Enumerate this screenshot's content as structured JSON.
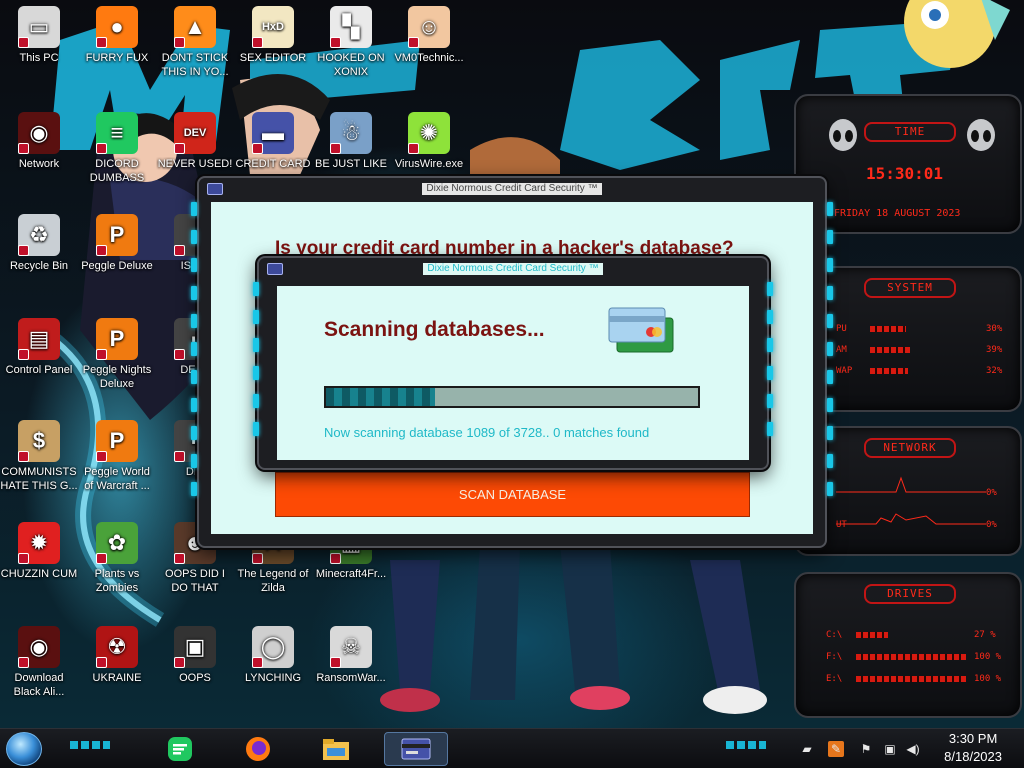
{
  "desktop": {
    "icons": [
      {
        "label": "This PC",
        "icon": "this-pc-icon"
      },
      {
        "label": "FURRY FUX",
        "icon": "firefox-icon"
      },
      {
        "label": "DONT STICK THIS IN YO...",
        "icon": "vlc-cone-icon"
      },
      {
        "label": "SEX EDITOR",
        "icon": "hxd-editor-icon"
      },
      {
        "label": "HOOKED ON XONIX",
        "icon": "xonix-game-icon"
      },
      {
        "label": "VM0Technic...",
        "icon": "doctor-icon"
      },
      {
        "label": "Network",
        "icon": "alien-network-icon"
      },
      {
        "label": "DICORD DUMBASS",
        "icon": "chat-app-icon"
      },
      {
        "label": "NEVER USED!",
        "icon": "dev-cpp-icon"
      },
      {
        "label": "CREDIT CARD",
        "icon": "credit-card-icon"
      },
      {
        "label": "BE JUST LIKE",
        "icon": "santa-icon"
      },
      {
        "label": "VirusWire.exe",
        "icon": "lime-icon"
      },
      {
        "label": "Recycle Bin",
        "icon": "recycle-bin-icon"
      },
      {
        "label": "Peggle Deluxe",
        "icon": "peggle-icon"
      },
      {
        "label": "ISRAI",
        "icon": "app-icon"
      },
      {
        "label": "Control Panel",
        "icon": "control-panel-icon"
      },
      {
        "label": "Peggle Nights Deluxe",
        "icon": "peggle-icon"
      },
      {
        "label": "DEEZ",
        "icon": "app-icon"
      },
      {
        "label": "COMMUNISTS HATE THIS G...",
        "icon": "money-bag-icon"
      },
      {
        "label": "Peggle World of Warcraft ...",
        "icon": "peggle-icon"
      },
      {
        "label": "DIE",
        "icon": "app-icon"
      },
      {
        "label": "CHUZZIN CUM",
        "icon": "chuzzle-icon"
      },
      {
        "label": "Plants vs Zombies",
        "icon": "plants-icon"
      },
      {
        "label": "OOPS DID I DO THAT",
        "icon": "person-icon"
      },
      {
        "label": "The Legend of Zilda",
        "icon": "zelda-icon"
      },
      {
        "label": "Minecraft4Fr...",
        "icon": "minecraft-icon"
      },
      {
        "label": "Download Black Ali...",
        "icon": "alien-download-icon"
      },
      {
        "label": "UKRAINE",
        "icon": "radiation-icon"
      },
      {
        "label": "OOPS",
        "icon": "oops-icon"
      },
      {
        "label": "LYNCHING",
        "icon": "noose-icon"
      },
      {
        "label": "RansomWar...",
        "icon": "skull-icon"
      }
    ]
  },
  "back_window": {
    "title": "Dixie Normous Credit Card Security ™",
    "heading": "Is your credit card number in a hacker's database?",
    "button_label": "SCAN DATABASE"
  },
  "front_window": {
    "title": "Dixie Normous Credit Card Security ™",
    "heading": "Scanning databases...",
    "progress_fraction": 0.292,
    "status": "Now scanning database 1089 of 3728.. 0 matches found"
  },
  "gadget": {
    "time": {
      "title": "TIME",
      "clock": "15:30:01",
      "date": "FRIDAY 18 AUGUST 2023"
    },
    "system": {
      "title": "SYSTEM",
      "rows": [
        {
          "label": "PU",
          "value": "30%"
        },
        {
          "label": "AM",
          "value": "39%"
        },
        {
          "label": "WAP",
          "value": "32%"
        }
      ]
    },
    "network": {
      "title": "NETWORK",
      "rows": [
        {
          "label": "",
          "value": "0%"
        },
        {
          "label": "UT",
          "value": "0%"
        }
      ]
    },
    "drives": {
      "title": "DRIVES",
      "rows": [
        {
          "label": "C:\\",
          "value": "27 %"
        },
        {
          "label": "F:\\",
          "value": "100 %"
        },
        {
          "label": "E:\\",
          "value": "100 %"
        }
      ]
    }
  },
  "taskbar": {
    "apps": [
      {
        "name": "chat-app-icon",
        "active": false
      },
      {
        "name": "firefox-icon",
        "active": false
      },
      {
        "name": "file-explorer-icon",
        "active": false
      },
      {
        "name": "credit-card-icon",
        "active": true
      }
    ],
    "clock_time": "3:30 PM",
    "clock_date": "8/18/2023"
  },
  "colors": {
    "accent_cyan": "#19c7e8",
    "heading_red": "#7b1311",
    "button_orange": "#fd4a05",
    "client_bg": "#dcfaf6",
    "gadget_red": "#ff2a1a"
  }
}
